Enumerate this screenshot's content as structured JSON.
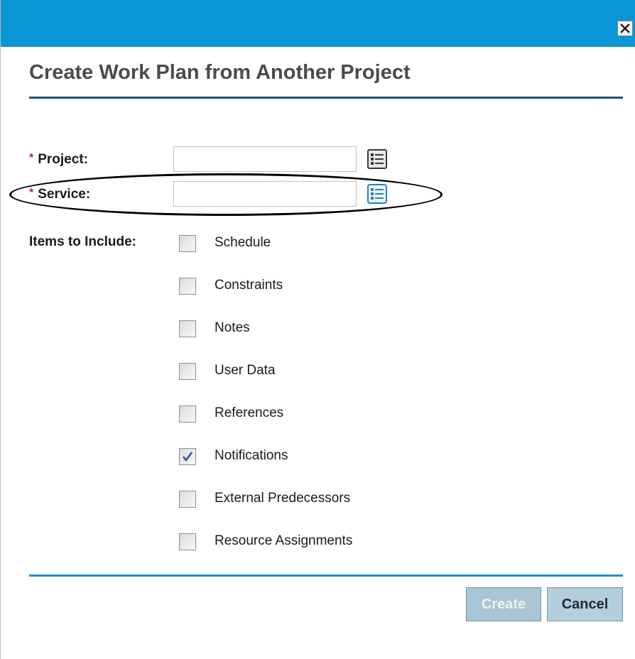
{
  "dialog": {
    "title": "Create Work Plan from Another Project",
    "close_icon": "close-icon",
    "colors": {
      "titlebar": "#0a96d6",
      "heading_rule": "#1d4f80",
      "footer_rule": "#1a8fd0",
      "required_marker": "#d02020"
    }
  },
  "form": {
    "required_marker": "*",
    "project": {
      "label": "Project:",
      "value": "",
      "picker_icon": "list-picker-icon"
    },
    "service": {
      "label": "Service:",
      "value": "",
      "picker_icon": "list-picker-icon"
    },
    "items_label": "Items to Include:",
    "items": [
      {
        "label": "Schedule",
        "checked": false
      },
      {
        "label": "Constraints",
        "checked": false
      },
      {
        "label": "Notes",
        "checked": false
      },
      {
        "label": "User Data",
        "checked": false
      },
      {
        "label": "References",
        "checked": false
      },
      {
        "label": "Notifications",
        "checked": true
      },
      {
        "label": "External Predecessors",
        "checked": false
      },
      {
        "label": "Resource Assignments",
        "checked": false
      }
    ]
  },
  "footer": {
    "create_label": "Create",
    "create_enabled": false,
    "cancel_label": "Cancel"
  }
}
